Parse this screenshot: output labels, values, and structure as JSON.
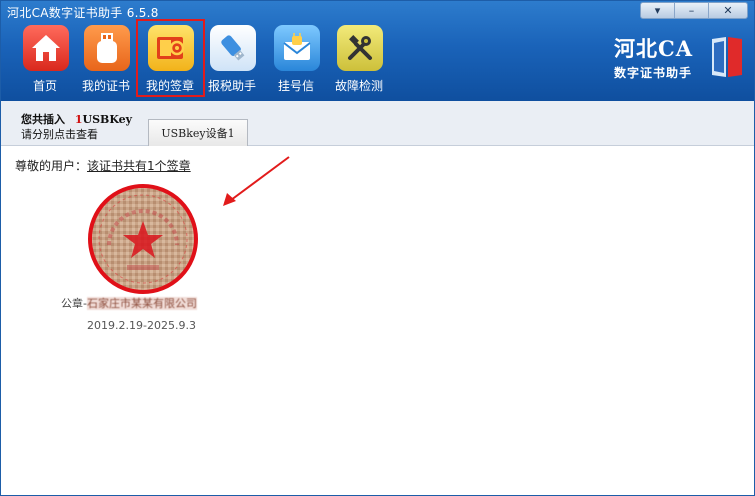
{
  "window": {
    "title": "河北CA数字证书助手  6.5.8",
    "controls": {
      "menu": "▾",
      "minimize": "–",
      "close": "✕"
    }
  },
  "toolbar": {
    "items": [
      {
        "label": "首页",
        "icon": "home-icon"
      },
      {
        "label": "我的证书",
        "icon": "usb-key-icon"
      },
      {
        "label": "我的签章",
        "icon": "seal-icon"
      },
      {
        "label": "报税助手",
        "icon": "usb-drive-icon"
      },
      {
        "label": "挂号信",
        "icon": "envelope-lock-icon"
      },
      {
        "label": "故障检测",
        "icon": "tools-icon"
      }
    ],
    "selected_index": 2
  },
  "brand": {
    "line1": "河北CA",
    "line2": "数字证书助手"
  },
  "info": {
    "insert_prefix": "您共插入",
    "insert_count": "1",
    "insert_suffix": "USBKey",
    "hint": "请分别点击查看"
  },
  "tabs": [
    {
      "label": "USBkey设备1",
      "active": true
    }
  ],
  "content": {
    "greeting_prefix": "尊敬的用户：",
    "greeting_message": "该证书共有1个签章",
    "seal": {
      "name_prefix": "公章-",
      "name_redacted": "石家庄市某某有限公司",
      "validity": "2019.2.19-2025.9.3"
    }
  },
  "colors": {
    "header_blue": "#1a63b9",
    "highlight_red": "#e21b1b",
    "seal_red": "#d9141c"
  }
}
